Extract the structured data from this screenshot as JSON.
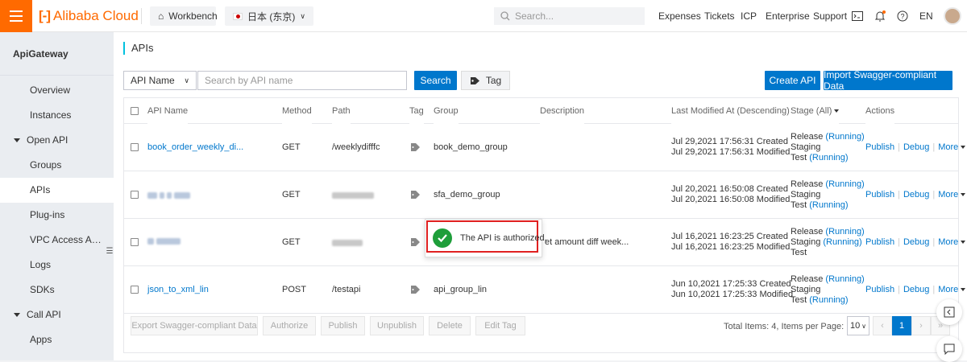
{
  "topbar": {
    "brand": "Alibaba Cloud",
    "workbench": "Workbench",
    "region": "日本 (东京)",
    "search_placeholder": "Search...",
    "nav": [
      "Expenses",
      "Tickets",
      "ICP",
      "Enterprise",
      "Support"
    ],
    "lang": "EN",
    "accent_color": "#ff6a00"
  },
  "sidebar": {
    "title": "ApiGateway",
    "items": [
      {
        "label": "Overview",
        "type": "item"
      },
      {
        "label": "Instances",
        "type": "item"
      },
      {
        "label": "Open API",
        "type": "group"
      },
      {
        "label": "Groups",
        "type": "item"
      },
      {
        "label": "APIs",
        "type": "item",
        "active": true
      },
      {
        "label": "Plug-ins",
        "type": "item"
      },
      {
        "label": "VPC Access Authori...",
        "type": "item"
      },
      {
        "label": "Logs",
        "type": "item"
      },
      {
        "label": "SDKs",
        "type": "item"
      },
      {
        "label": "Call API",
        "type": "group"
      },
      {
        "label": "Apps",
        "type": "item"
      }
    ]
  },
  "main": {
    "title": "APIs",
    "filter_select": "API Name",
    "search_placeholder": "Search by API name",
    "search_button": "Search",
    "tag_button": "Tag",
    "create_button": "Create API",
    "import_button": "Import Swagger-compliant Data",
    "primary_color": "#0077cc"
  },
  "table": {
    "headers": {
      "name": "API Name",
      "method": "Method",
      "path": "Path",
      "tag": "Tag",
      "group": "Group",
      "description": "Description",
      "modified": "Last Modified At (Descending)",
      "stage": "Stage (All)",
      "actions": "Actions"
    },
    "rows": [
      {
        "name": "book_order_weekly_di...",
        "name_redacted": false,
        "method": "GET",
        "path": "/weeklydifffc",
        "path_redacted": false,
        "group": "book_demo_group",
        "description": "",
        "created": "Jul 29,2021 17:56:31 Created",
        "modified": "Jul 29,2021 17:56:31 Modified",
        "stage_release": "Release",
        "stage_release_status": "(Running)",
        "stage_staging": "Staging",
        "stage_staging_status": "",
        "stage_test": "Test",
        "stage_test_status": "(Running)"
      },
      {
        "name": "",
        "name_redacted": true,
        "method": "GET",
        "path": "",
        "path_redacted": true,
        "group": "sfa_demo_group",
        "description": "",
        "created": "Jul 20,2021 16:50:08 Created",
        "modified": "Jul 20,2021 16:50:08 Modified",
        "stage_release": "Release",
        "stage_release_status": "(Running)",
        "stage_staging": "Staging",
        "stage_staging_status": "",
        "stage_test": "Test",
        "stage_test_status": "(Running)"
      },
      {
        "name": "",
        "name_redacted": true,
        "method": "GET",
        "path": "",
        "path_redacted": true,
        "group": "",
        "description": "et amount diff week...",
        "created": "Jul 16,2021 16:23:25 Created",
        "modified": "Jul 16,2021 16:23:25 Modified",
        "stage_release": "Release",
        "stage_release_status": "(Running)",
        "stage_staging": "Staging",
        "stage_staging_status": "(Running)",
        "stage_test": "Test",
        "stage_test_status": ""
      },
      {
        "name": "json_to_xml_lin",
        "name_redacted": false,
        "method": "POST",
        "path": "/testapi",
        "path_redacted": false,
        "group": "api_group_lin",
        "description": "",
        "created": "Jun 10,2021 17:25:33 Created",
        "modified": "Jun 10,2021 17:25:33 Modified",
        "stage_release": "Release",
        "stage_release_status": "(Running)",
        "stage_staging": "Staging",
        "stage_staging_status": "",
        "stage_test": "Test",
        "stage_test_status": "(Running)"
      }
    ],
    "row_actions": {
      "publish": "Publish",
      "debug": "Debug",
      "more": "More"
    },
    "footer_buttons": [
      "Export Swagger-compliant Data",
      "Authorize",
      "Publish",
      "Unpublish",
      "Delete",
      "Edit Tag"
    ],
    "total_text": "Total Items: 4, Items per Page: 10",
    "page_size": "10",
    "current_page": "1"
  },
  "toast": {
    "message": "The API is authorized.",
    "success_color": "#1e9e3a",
    "highlight_color": "#e02020"
  }
}
